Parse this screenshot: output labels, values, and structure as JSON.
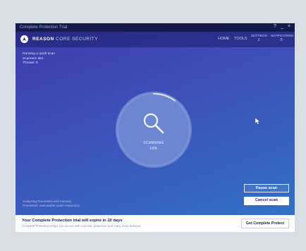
{
  "window": {
    "title": "Complete Protection Trial",
    "controls": [
      "?",
      "_",
      "×"
    ]
  },
  "header": {
    "brand_bold": "REASON",
    "brand_rest": "CORE SECURITY",
    "nav": {
      "home": "HOME",
      "tools": "TOOLS",
      "settings": "SETTINGS",
      "settings_badge": "1",
      "notifications": "NOTIFICATIONS",
      "notifications_badge": "0"
    }
  },
  "status": {
    "line1": "Running a quick scan",
    "line2": "Scanned: 551",
    "line3": "Threats: 0"
  },
  "scan": {
    "label": "SCANNING",
    "percent_text": "10%",
    "progress": 0.1
  },
  "analyzing": {
    "line1": "Analyzing Processes and memory",
    "line2": "Processes: executable under inspection"
  },
  "buttons": {
    "pause": "Pause scan",
    "cancel": "Cancel scan"
  },
  "pager": {
    "prev": "‹",
    "next": "›"
  },
  "promo": {
    "title": "Your Complete Protection trial will expire in 10 days",
    "subtitle": "Complete Protection keeps you secure with real-time protection and many more features",
    "button": "Get Complete Protect"
  },
  "colors": {
    "titlebar": "#141a4d",
    "accent": "#3e4fb8",
    "button_text": "#1e2470"
  }
}
